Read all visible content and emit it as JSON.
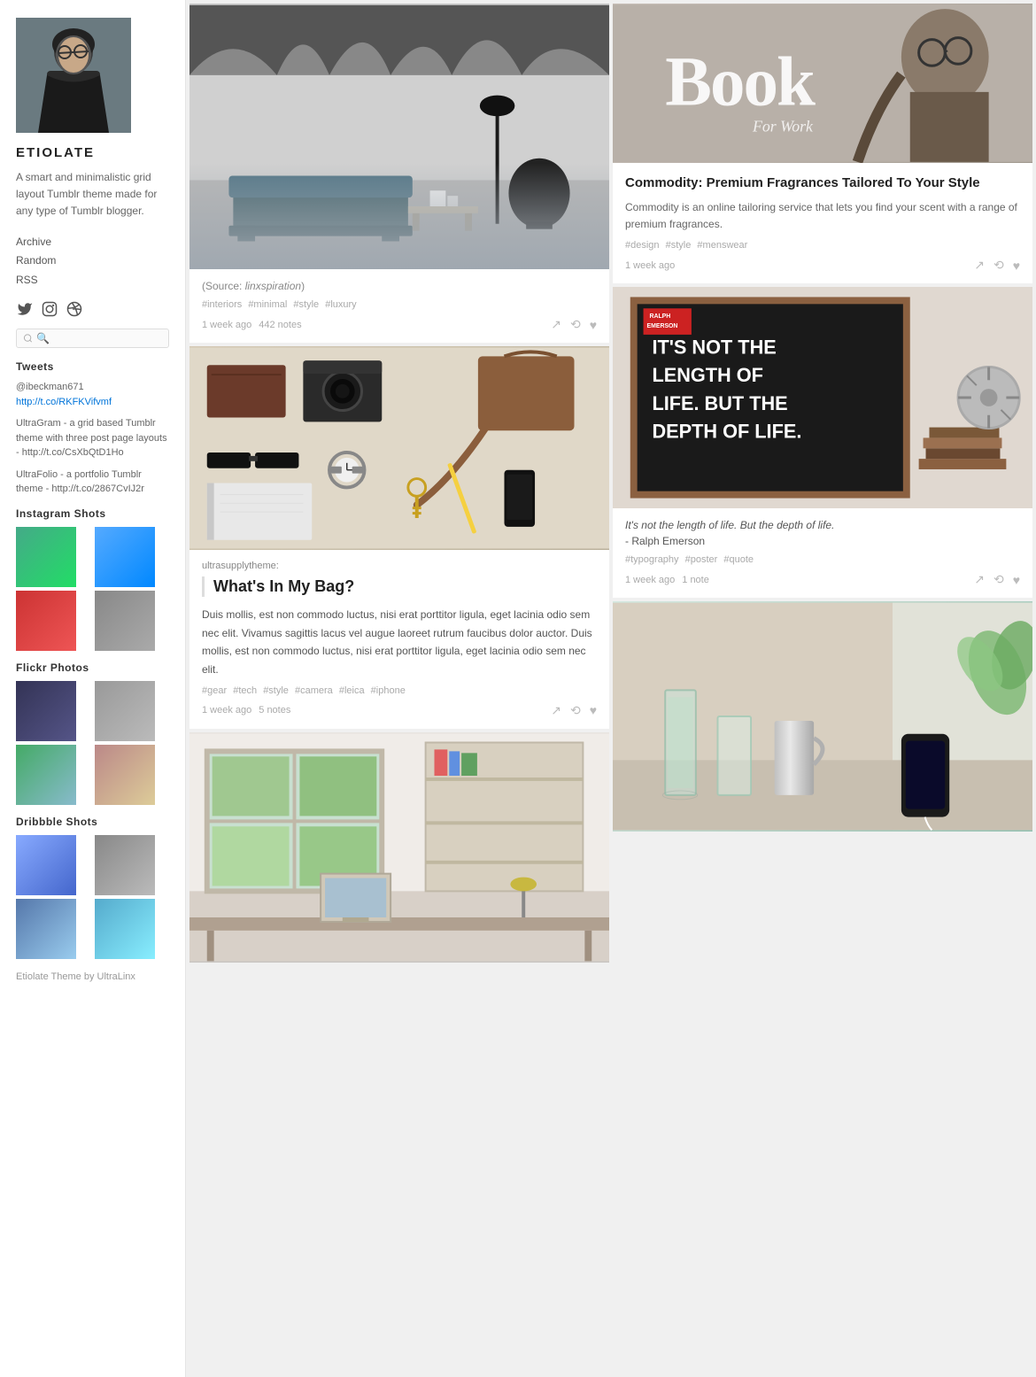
{
  "sidebar": {
    "blog_name": "ETIOLATE",
    "description": "A smart and minimalistic grid layout Tumblr theme made for any type of Tumblr blogger.",
    "links": [
      {
        "label": "Archive",
        "href": "#"
      },
      {
        "label": "Random",
        "href": "#"
      },
      {
        "label": "RSS",
        "href": "#"
      }
    ],
    "social_icons": [
      {
        "name": "twitter-icon",
        "symbol": "🐦"
      },
      {
        "name": "instagram-icon",
        "symbol": "📷"
      },
      {
        "name": "dribbble-icon",
        "symbol": "🏀"
      }
    ],
    "search_placeholder": "🔍",
    "tweets_section": "Tweets",
    "tweets": [
      {
        "handle": "@ibeckman671",
        "link_text": "http://t.co/RKFKVifvmf"
      },
      {
        "text": "UltraGram - a grid based Tumblr theme with three post page layouts - http://t.co/CsXbQtD1Ho"
      },
      {
        "text": "UltraFolio - a portfolio Tumblr theme - http://t.co/2867CvIJ2r"
      }
    ],
    "instagram_section": "Instagram Shots",
    "flickr_section": "Flickr Photos",
    "dribbble_section": "Dribbble Shots",
    "footer": "Etiolate Theme by UltraLinx"
  },
  "posts": {
    "interior": {
      "source_prefix": "(Source: ",
      "source_link": "linxspiration",
      "source_suffix": ")",
      "tags": [
        "#interiors",
        "#minimal",
        "#style",
        "#luxury"
      ],
      "time": "1 week ago",
      "notes": "442 notes"
    },
    "bag": {
      "attr": "ultrasupplytheme:",
      "title": "What's In My Bag?",
      "text": "Duis mollis, est non commodo luctus, nisi erat porttitor ligula, eget lacinia odio sem nec elit. Vivamus sagittis lacus vel augue laoreet rutrum faucibus dolor auctor. Duis mollis, est non commodo luctus, nisi erat porttitor ligula, eget lacinia odio sem nec elit.",
      "tags": [
        "#gear",
        "#tech",
        "#style",
        "#camera",
        "#leica",
        "#iphone"
      ],
      "time": "1 week ago",
      "notes": "5 notes"
    },
    "book": {
      "image_big_text": "Book",
      "image_sub_text": "For Work",
      "title": "Commodity: Premium Fragrances Tailored To Your Style",
      "description": "Commodity is an online tailoring service that lets you find your scent with a range of premium fragrances.",
      "tags": [
        "#design",
        "#style",
        "#menswear"
      ],
      "time": "1 week ago",
      "notes": ""
    },
    "quote": {
      "quote_line1": "IT'S NOT THE",
      "quote_line2": "LENGTH OF",
      "quote_line3": "LIFE. BUT THE",
      "quote_line4": "DEPTH OF LIFE.",
      "badge_text": "RALPH\nEMERSON",
      "italic_text": "It's not the length of life. But the depth of life.",
      "author": "- Ralph Emerson",
      "tags": [
        "#typography",
        "#poster",
        "#quote"
      ],
      "time": "1 week ago",
      "notes": "1 note"
    },
    "room": {
      "image_alt": "Room with window"
    },
    "drink": {
      "image_alt": "Drinks on table"
    }
  },
  "actions": {
    "share": "↗",
    "reblog": "⟲",
    "like": "♥"
  }
}
